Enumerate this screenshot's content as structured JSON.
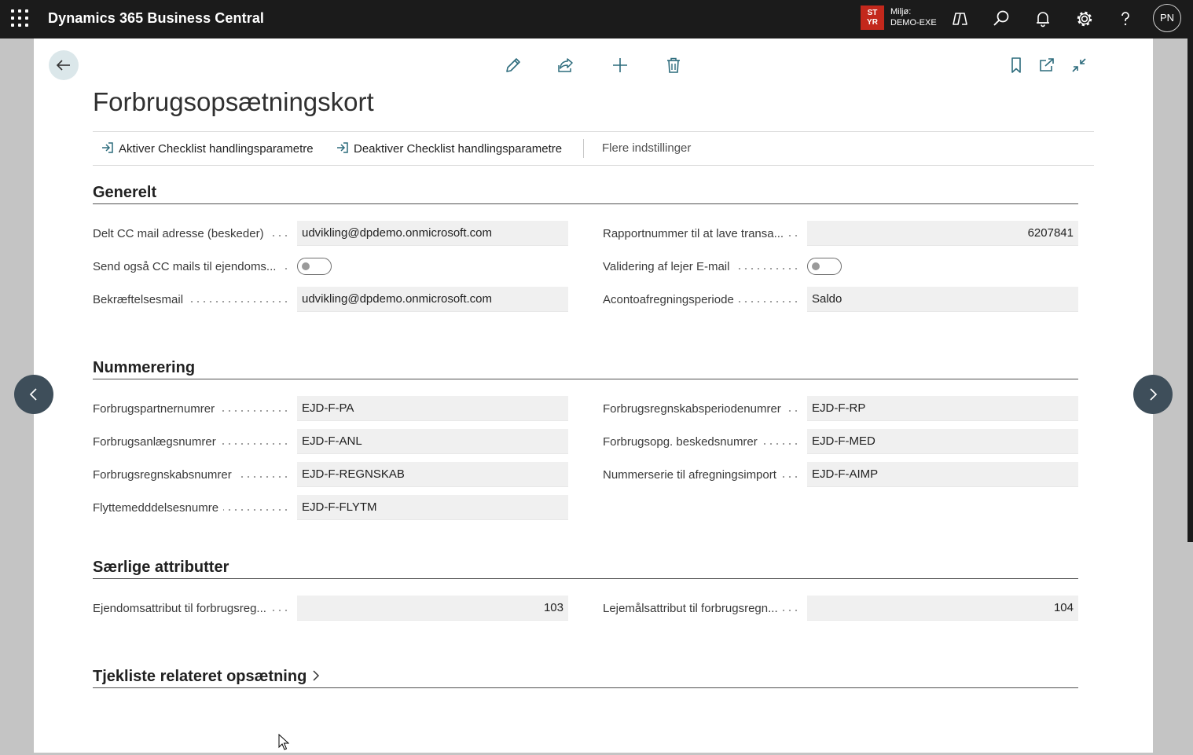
{
  "app": {
    "title": "Dynamics 365 Business Central",
    "environment_badge_line1": "ST",
    "environment_badge_line2": "YR",
    "environment_label": "Miljø:",
    "environment_name": "DEMO-EXE",
    "user_initials": "PN"
  },
  "page": {
    "title": "Forbrugsopsætningskort"
  },
  "actions": {
    "activate_label": "Aktiver Checklist handlingsparametre",
    "deactivate_label": "Deaktiver Checklist handlingsparametre",
    "more_label": "Flere indstillinger"
  },
  "sections": {
    "general": {
      "title": "Generelt",
      "cc_mail_label": "Delt CC mail adresse (beskeder)",
      "cc_mail_value": "udvikling@dpdemo.onmicrosoft.com",
      "send_cc_label": "Send også CC mails til ejendoms...",
      "confirmation_mail_label": "Bekræftelsesmail",
      "confirmation_mail_value": "udvikling@dpdemo.onmicrosoft.com",
      "report_number_label": "Rapportnummer til at lave transa...",
      "report_number_value": "6207841",
      "validate_tenant_label": "Validering af lejer E-mail",
      "settlement_period_label": "Acontoafregningsperiode",
      "settlement_period_value": "Saldo"
    },
    "numbering": {
      "title": "Nummerering",
      "partner_label": "Forbrugspartnernumrer",
      "partner_value": "EJD-F-PA",
      "installation_label": "Forbrugsanlægsnumrer",
      "installation_value": "EJD-F-ANL",
      "accounting_label": "Forbrugsregnskabsnumrer",
      "accounting_value": "EJD-F-REGNSKAB",
      "moving_label": "Flyttemedddelsesnumre",
      "moving_value": "EJD-F-FLYTM",
      "period_label": "Forbrugsregnskabsperiodenumrer",
      "period_value": "EJD-F-RP",
      "message_label": "Forbrugsopg. beskedsnumrer",
      "message_value": "EJD-F-MED",
      "import_label": "Nummerserie til afregningsimport",
      "import_value": "EJD-F-AIMP"
    },
    "attributes": {
      "title": "Særlige attributter",
      "property_attr_label": "Ejendomsattribut til forbrugsreg...",
      "property_attr_value": "103",
      "lease_attr_label": "Lejemålsattribut til forbrugsregn...",
      "lease_attr_value": "104"
    },
    "checklist": {
      "title": "Tjekliste relateret opsætning"
    }
  },
  "toggles": {
    "send_cc": false,
    "validate_tenant": false
  },
  "icons": {
    "waffle": "app-launcher-icon",
    "copilot": "copilot-icon",
    "search": "search-icon",
    "bell": "bell-icon",
    "gear": "gear-icon",
    "help": "help-icon",
    "back": "back-arrow-icon",
    "edit": "pencil-icon",
    "share": "share-icon",
    "new": "plus-icon",
    "delete": "trash-icon",
    "bookmark": "bookmark-icon",
    "open_new": "open-new-window-icon",
    "collapse": "collapse-icon"
  }
}
